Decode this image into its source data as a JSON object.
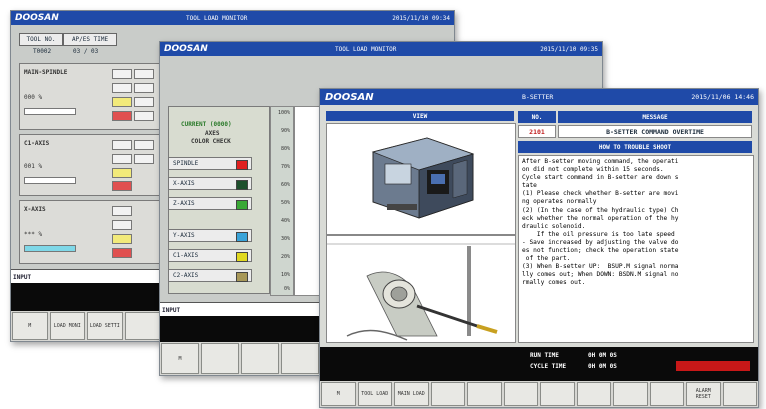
{
  "brand": "DOOSAN",
  "win1": {
    "title": "TOOL LOAD MONITOR",
    "datetime": "2015/11/10 09:34",
    "tool_no_label": "TOOL NO.",
    "ap_es_time_label": "AP/ES TIME",
    "tool_value": "T0002",
    "tool_value2": "03 / 03",
    "main_spindle_label": "MAIN-SPINDLE",
    "main_spindle_pct_label": "000 %",
    "c1_axis_label": "C1-AXIS",
    "c1_pct_label": "001 %",
    "x_axis_label": "X-AXIS",
    "x_pct_label": "*** %",
    "input_label": "INPUT",
    "fkeys": [
      "M",
      "LOAD MONI",
      "LOAD SETTI",
      "",
      "",
      ""
    ]
  },
  "win2": {
    "title": "TOOL LOAD MONITOR",
    "datetime": "2015/11/10 09:35",
    "current_label": "CURRENT (0000)",
    "axes_label": "AXES",
    "color_check_label": "COLOR CHECK",
    "legend": [
      {
        "name": "SPINDLE",
        "color": "#e02020"
      },
      {
        "name": "X-AXIS",
        "color": "#1d4f2c"
      },
      {
        "name": "Z-AXIS",
        "color": "#3aa836"
      },
      {
        "name": "Y-AXIS",
        "color": "#3aa3d8"
      },
      {
        "name": "C1-AXIS",
        "color": "#e0d820"
      },
      {
        "name": "C2-AXIS",
        "color": "#a89858"
      }
    ],
    "scale": [
      "100%",
      "90%",
      "80%",
      "70%",
      "60%",
      "50%",
      "40%",
      "30%",
      "20%",
      "10%",
      "0%"
    ],
    "input_label": "INPUT",
    "fkeys": [
      "M",
      "",
      "",
      "",
      "",
      ""
    ]
  },
  "win3": {
    "title": "B-SETTER",
    "datetime": "2015/11/06 14:46",
    "view_header": "VIEW",
    "no_header": "NO.",
    "message_header": "MESSAGE",
    "alarm_no": "2101",
    "alarm_message": "B-SETTER COMMAND OVERTIME",
    "trouble_header": "HOW TO TROUBLE SHOOT",
    "trouble_text": "After B-setter moving command, the operati\non did not complete within 15 seconds.\nCycle start command in B-setter are down s\ntate\n(1) Please check whether B-setter are movi\nng operates normally\n(2) (In the case of the hydraulic type) Ch\neck whether the normal operation of the hy\ndraulic solenoid.\n    If the oil pressure is too late speed\n- Save increased by adjusting the valve do\nes not function; check the operation state\n of the part.\n(3) When B-setter UP:  BSUP.M signal norma\nlly comes out; When DOWN: BSDN.M signal no\nrmally comes out.",
    "run_time_label": "RUN TIME",
    "cycle_time_label": "CYCLE TIME",
    "run_time_value": "0H 0M 0S",
    "cycle_time_value": "0H 0M 0S",
    "fkeys": [
      "M",
      "TOOL LOAD",
      "MAIN LOAD",
      "",
      "",
      "",
      "",
      "",
      "",
      "",
      "ALARM RESET",
      ""
    ]
  }
}
